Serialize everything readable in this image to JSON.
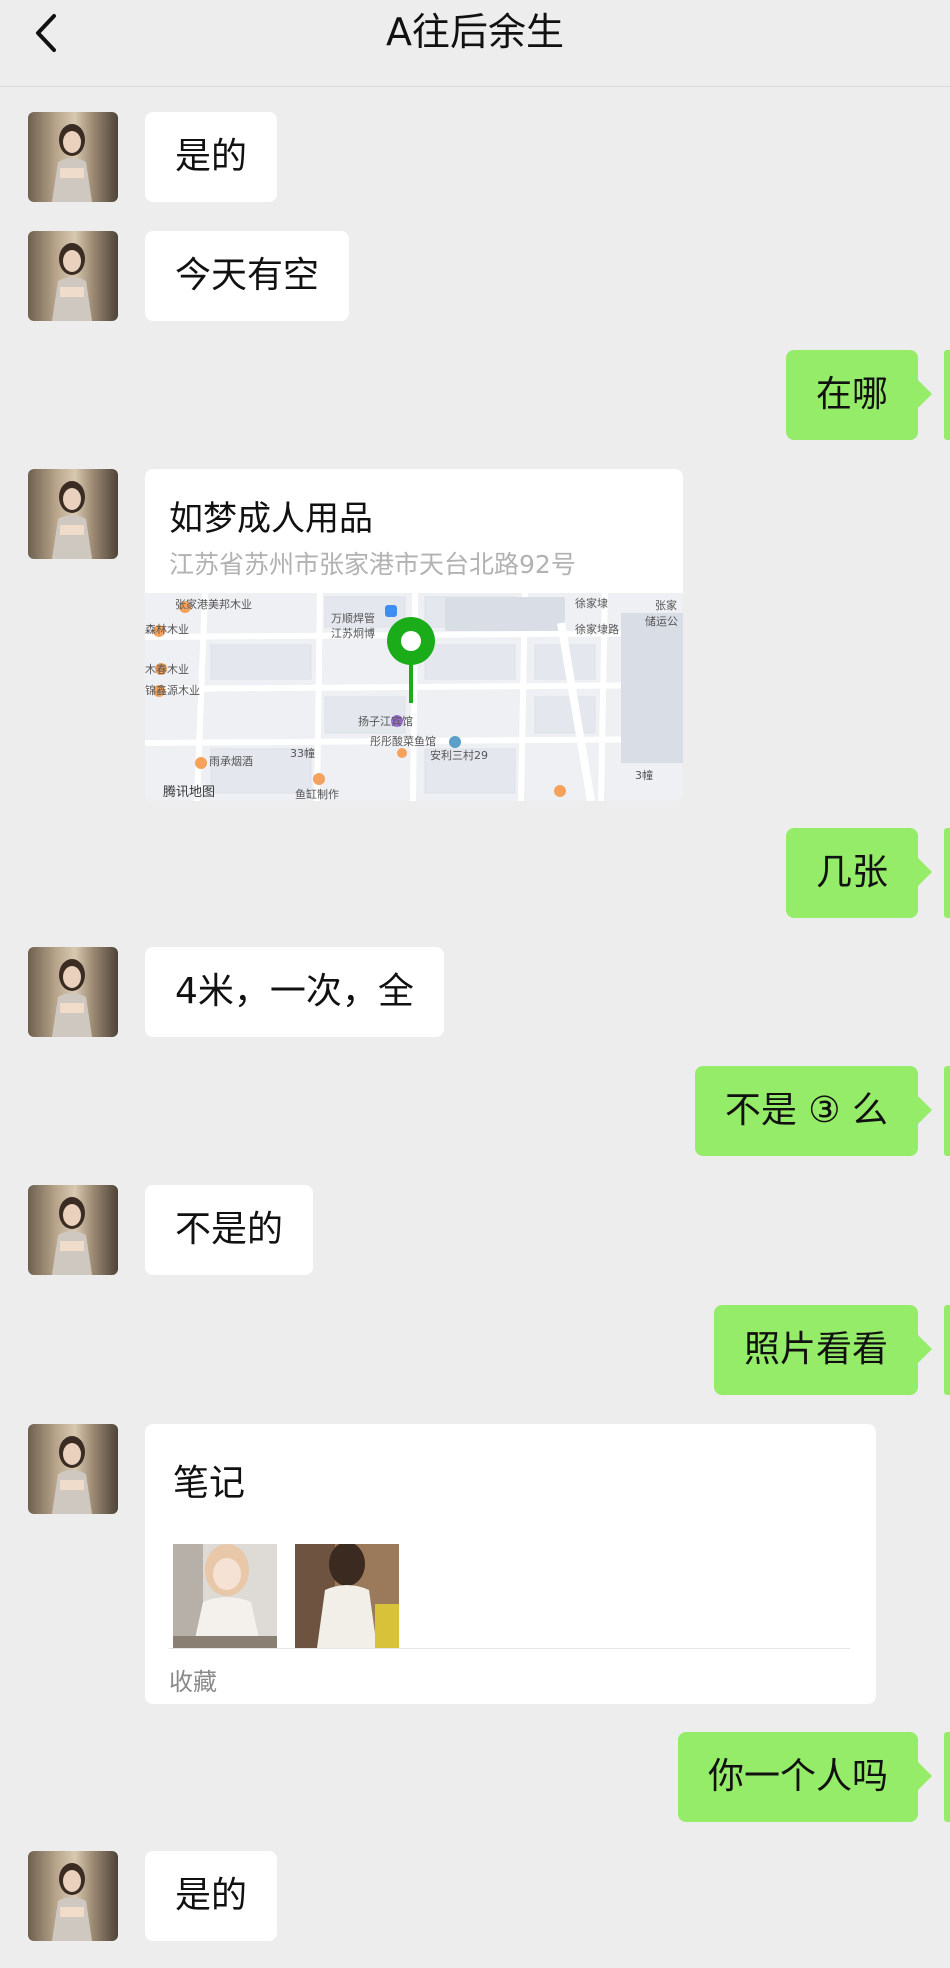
{
  "header": {
    "title": "A往后余生",
    "back_icon": "chevron-left-icon"
  },
  "colors": {
    "background": "#ededed",
    "incoming_bubble": "#ffffff",
    "outgoing_bubble": "#95ec69",
    "pin": "#1aad19"
  },
  "messages": [
    {
      "side": "in",
      "text": "是的"
    },
    {
      "side": "in",
      "text": "今天有空"
    },
    {
      "side": "out",
      "text": "在哪"
    },
    {
      "side": "in",
      "type": "location",
      "name": "如梦成人用品",
      "address": "江苏省苏州市张家港市天台北路92号"
    },
    {
      "side": "out",
      "text": "几张"
    },
    {
      "side": "in",
      "text": "4米，一次，全"
    },
    {
      "side": "out",
      "text": "不是 ③ 么"
    },
    {
      "side": "in",
      "text": "不是的"
    },
    {
      "side": "out",
      "text": "照片看看"
    },
    {
      "side": "in",
      "type": "note",
      "title": "笔记",
      "source": "收藏"
    },
    {
      "side": "out",
      "text": "你一个人吗"
    },
    {
      "side": "in",
      "text": "是的"
    }
  ],
  "map": {
    "labels": [
      "张家港美邦木业",
      "森林木业",
      "木春木业",
      "锦鑫源木业",
      "雨承烟酒",
      "腾讯地图",
      "万顺焊管",
      "江苏炯博",
      "扬子江宾馆",
      "彤彤酸菜鱼馆",
      "安利三村29",
      "鱼缸制作",
      "33幢",
      "徐家埭",
      "徐家埭路",
      "张家",
      "储运公",
      "3幢"
    ]
  }
}
